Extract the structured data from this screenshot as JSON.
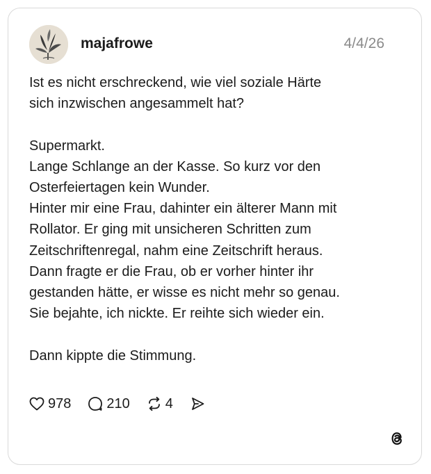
{
  "post": {
    "username": "majafrowe",
    "date": "4/4/26",
    "paragraphs": [
      "Ist es nicht erschreckend, wie viel soziale Härte\nsich inzwischen angesammelt hat?",
      "Supermarkt.\nLange Schlange an der Kasse. So kurz vor den\nOsterfeiertagen kein Wunder.\nHinter mir eine Frau, dahinter ein älterer Mann mit\nRollator. Er ging mit unsicheren Schritten zum\nZeitschriftenregal, nahm eine Zeitschrift heraus.\nDann fragte er die Frau, ob er vorher hinter ihr\ngestanden hätte, er wisse es nicht mehr so genau.\nSie bejahte, ich nickte. Er reihte sich wieder ein.",
      "Dann kippte die Stimmung."
    ],
    "likes": "978",
    "replies": "210",
    "reposts": "4"
  },
  "icons": {
    "avatar": "leaf-plant-avatar",
    "like": "heart-icon",
    "reply": "speech-bubble-icon",
    "repost": "repost-arrows-icon",
    "share": "send-icon",
    "brand": "threads-logo-icon"
  },
  "colors": {
    "text": "#1b1b1b",
    "muted": "#8a8a8a",
    "border": "#d9d9d9",
    "background": "#ffffff"
  }
}
